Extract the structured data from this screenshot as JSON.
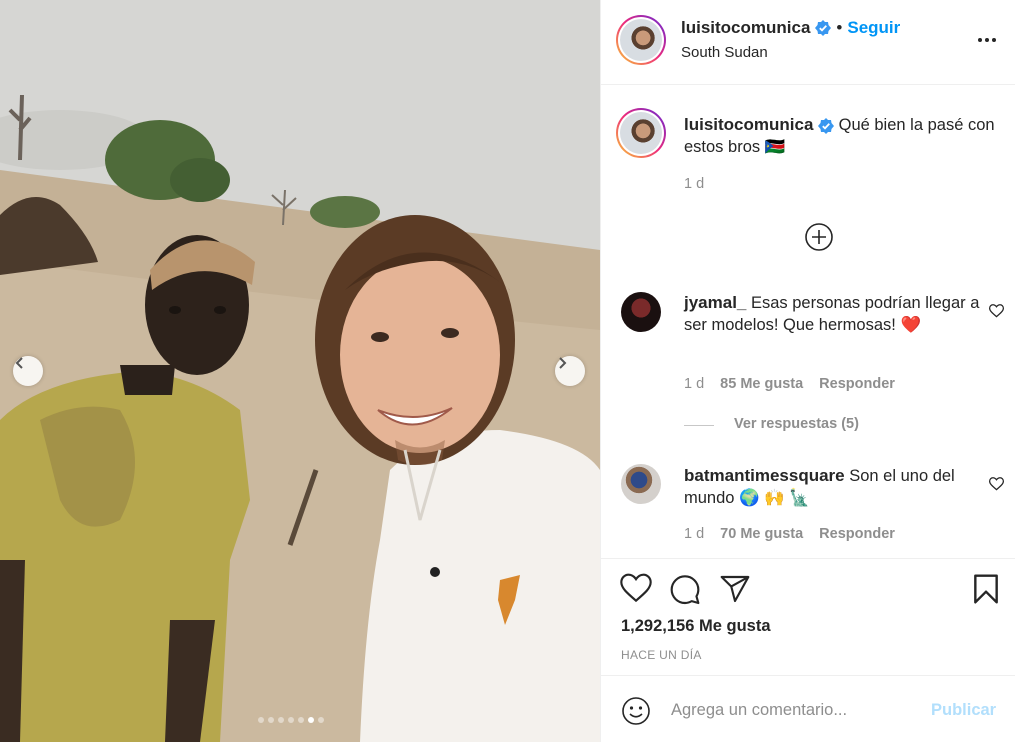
{
  "post": {
    "image_dots": {
      "count": 7,
      "active_index": 5
    }
  },
  "header": {
    "username": "luisitocomunica",
    "bullet": "•",
    "follow_label": "Seguir",
    "location": "South Sudan"
  },
  "caption": {
    "username": "luisitocomunica",
    "text": "Qué bien la pasé con estos bros",
    "emoji": "🇸🇸",
    "time": "1 d"
  },
  "comments": [
    {
      "username": "jyamal_",
      "text": "Esas personas podrían llegar a ser modelos! Que hermosas!",
      "emoji": "❤️",
      "time": "1 d",
      "likes": "85 Me gusta",
      "reply_label": "Responder"
    },
    {
      "username": "batmantimessquare",
      "text": "Son el uno del mundo",
      "emoji": "🌍 🙌 🗽",
      "time": "1 d",
      "likes": "70 Me gusta",
      "reply_label": "Responder"
    }
  ],
  "replies": {
    "label": "Ver respuestas (5)"
  },
  "actions": {
    "likes": "1,292,156 Me gusta",
    "timestamp": "HACE UN DÍA"
  },
  "add_comment": {
    "placeholder": "Agrega un comentario...",
    "publish_label": "Publicar"
  },
  "colors": {
    "link": "#0095f6",
    "publish_disabled": "#b2dffc",
    "secondary_text": "#8e8e8e",
    "verified": "#3897f0",
    "heart_red": "#ed4956"
  }
}
